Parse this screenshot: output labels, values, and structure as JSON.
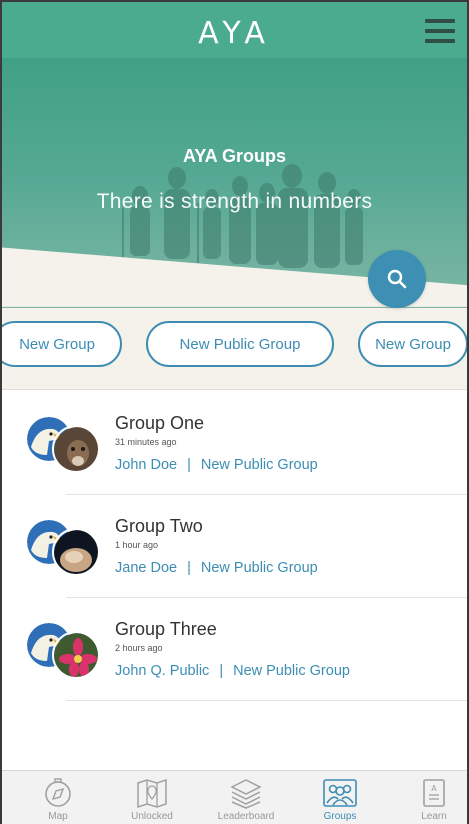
{
  "app": {
    "logo_text": "AYA"
  },
  "hero": {
    "title": "AYA Groups",
    "subtitle": "There is strength in numbers"
  },
  "pills": [
    {
      "label": "New Group"
    },
    {
      "label": "New Public Group"
    },
    {
      "label": "New Group"
    }
  ],
  "groups": [
    {
      "name": "Group One",
      "time": "31 minutes ago",
      "owner": "John Doe",
      "type": "New Public Group"
    },
    {
      "name": "Group Two",
      "time": "1 hour ago",
      "owner": "Jane Doe",
      "type": "New Public Group"
    },
    {
      "name": "Group Three",
      "time": "2 hours ago",
      "owner": "John Q. Public",
      "type": "New Public Group"
    }
  ],
  "nav": [
    {
      "label": "Map",
      "icon": "compass-icon"
    },
    {
      "label": "Unlocked",
      "icon": "map-pin-icon"
    },
    {
      "label": "Leaderboard",
      "icon": "layers-icon"
    },
    {
      "label": "Groups",
      "icon": "people-icon",
      "active": true
    },
    {
      "label": "Learn",
      "icon": "book-icon"
    }
  ],
  "colors": {
    "primary_green": "#4aab8e",
    "accent_blue": "#3d8db3",
    "cream": "#f4f2ea"
  }
}
